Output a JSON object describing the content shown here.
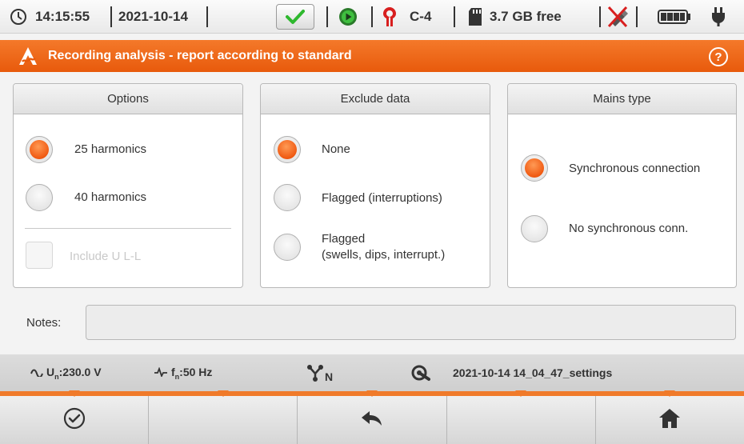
{
  "status": {
    "time": "14:15:55",
    "date": "2021-10-14",
    "clamp_label": "C-4",
    "storage_free": "3.7 GB free",
    "icons": [
      "clock-icon",
      "check-icon",
      "record-play-icon",
      "clamp-icon",
      "sd-card-icon",
      "usb-disconnected-icon",
      "battery-icon",
      "power-plug-icon"
    ]
  },
  "title": {
    "text": "Recording analysis - report according to standard",
    "help": "?"
  },
  "options": {
    "header": "Options",
    "harmonics": [
      {
        "label": "25 harmonics",
        "selected": true
      },
      {
        "label": "40 harmonics",
        "selected": false
      }
    ],
    "include_ull": {
      "label": "Include U L-L",
      "checked": false,
      "enabled": false
    }
  },
  "exclude": {
    "header": "Exclude data",
    "items": [
      {
        "label": "None",
        "selected": true
      },
      {
        "label": "Flagged (interruptions)",
        "selected": false
      },
      {
        "label_line1": "Flagged",
        "label_line2": "(swells, dips, interrupt.)",
        "selected": false
      }
    ]
  },
  "mains": {
    "header": "Mains type",
    "items": [
      {
        "label": "Synchronous connection",
        "selected": true
      },
      {
        "label": "No synchronous conn.",
        "selected": false
      }
    ]
  },
  "notes": {
    "label": "Notes:",
    "value": ""
  },
  "info": {
    "voltage_prefix": "U",
    "voltage_sub": "n",
    "voltage_value": ":230.0 V",
    "freq_prefix": "f",
    "freq_sub": "n",
    "freq_value": ":50 Hz",
    "network_sub": "N",
    "settings_file": "2021-10-14 14_04_47_settings"
  },
  "buttons": [
    "confirm-button",
    "empty-button-2",
    "back-button",
    "empty-button-4",
    "home-button"
  ],
  "colors": {
    "accent": "#f0661a",
    "check_green": "#2eb82e"
  }
}
